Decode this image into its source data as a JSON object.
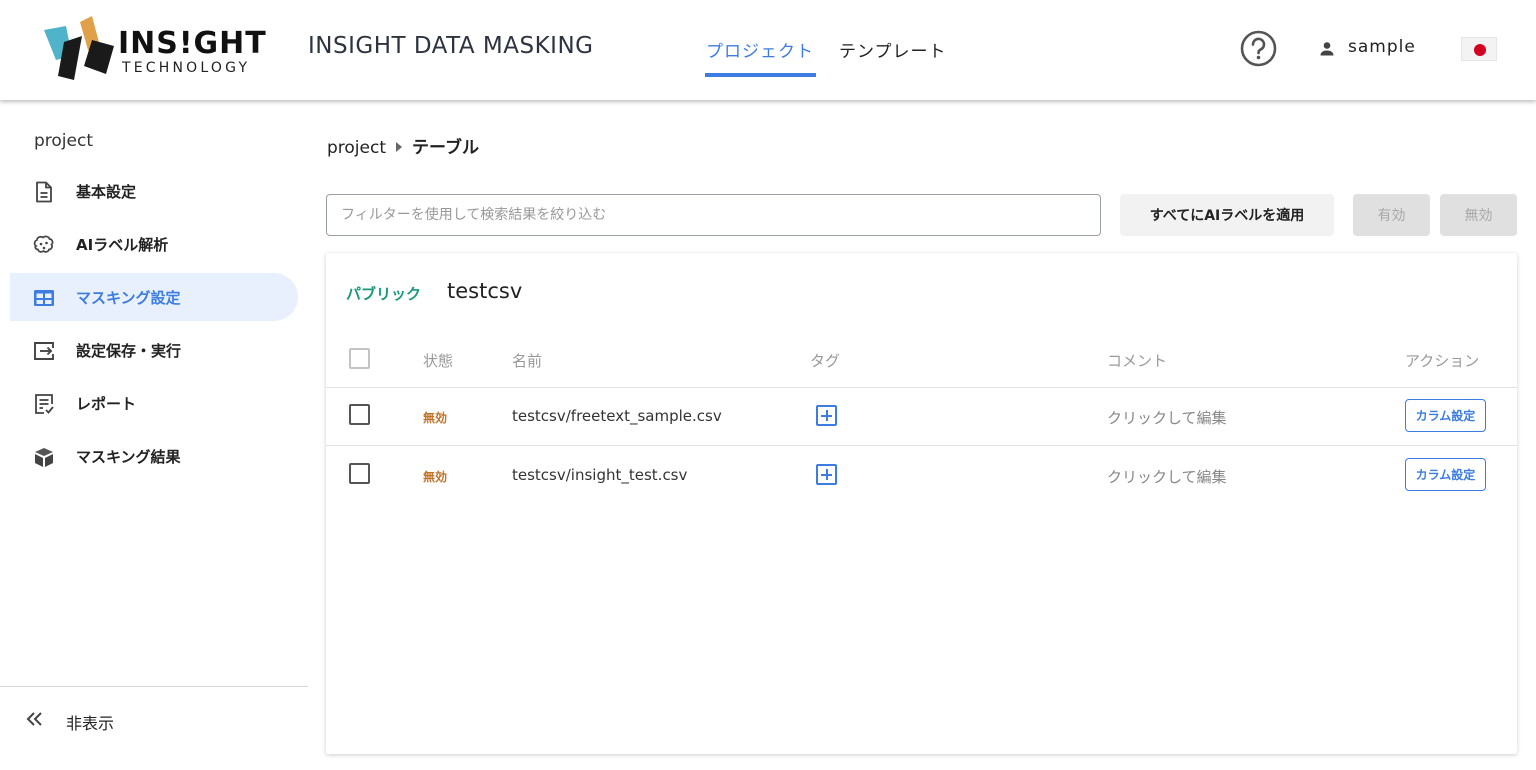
{
  "header": {
    "logo_main": "INS!GHT",
    "logo_sub": "TECHNOLOGY",
    "app_title": "INSIGHT DATA MASKING",
    "tabs": [
      {
        "label": "プロジェクト",
        "active": true
      },
      {
        "label": "テンプレート",
        "active": false
      }
    ],
    "help_icon": "help-circle-icon",
    "user_icon": "person-icon",
    "user_name": "sample",
    "language_flag": "japan-flag-icon",
    "accent_color": "#3d7ce0"
  },
  "sidebar": {
    "project_name": "project",
    "items": [
      {
        "label": "基本設定",
        "icon": "document-icon",
        "active": false
      },
      {
        "label": "AIラベル解析",
        "icon": "brain-icon",
        "active": false
      },
      {
        "label": "マスキング設定",
        "icon": "table-icon",
        "active": true
      },
      {
        "label": "設定保存・実行",
        "icon": "export-icon",
        "active": false
      },
      {
        "label": "レポート",
        "icon": "report-icon",
        "active": false
      },
      {
        "label": "マスキング結果",
        "icon": "box-icon",
        "active": false
      }
    ],
    "hide_label": "非表示",
    "hide_icon": "double-chevron-left-icon"
  },
  "main": {
    "breadcrumb": {
      "parent": "project",
      "current": "テーブル"
    },
    "filter_placeholder": "フィルターを使用して検索結果を絞り込む",
    "filter_value": "",
    "apply_ai_label": "すべてにAIラベルを適用",
    "enable_label": "有効",
    "disable_label": "無効",
    "card": {
      "scope": "パブリック",
      "title": "testcsv",
      "scope_color": "#1a9a7b",
      "columns": [
        "状態",
        "名前",
        "タグ",
        "コメント",
        "アクション"
      ],
      "rows": [
        {
          "status": "無効",
          "name": "testcsv/freetext_sample.csv",
          "comment": "クリックして編集",
          "action": "カラム設定"
        },
        {
          "status": "無効",
          "name": "testcsv/insight_test.csv",
          "comment": "クリックして編集",
          "action": "カラム設定"
        }
      ]
    }
  }
}
